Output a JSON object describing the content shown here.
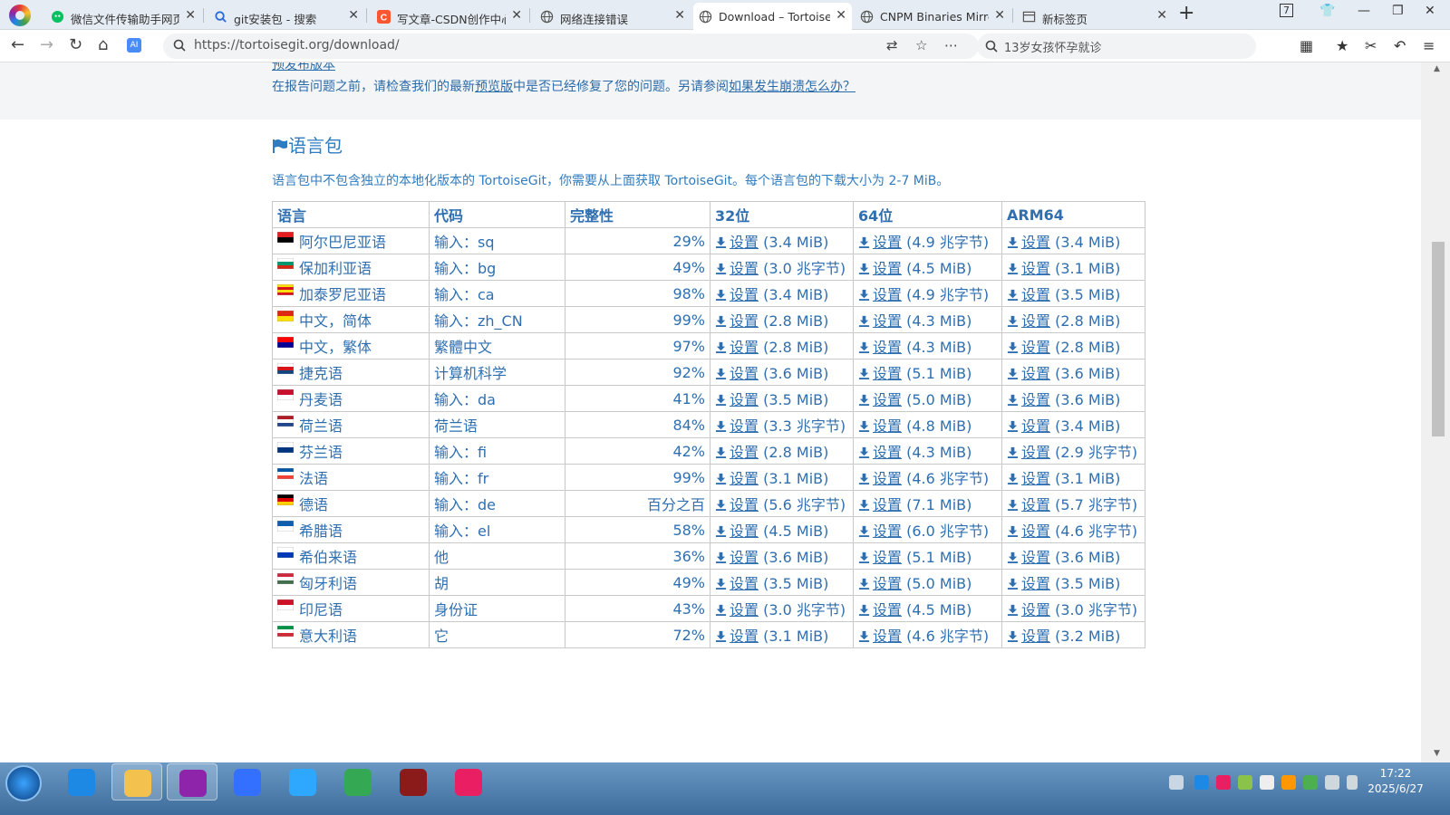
{
  "tabs": [
    {
      "title": "微信文件传输助手网页",
      "icon": "wechat-icon"
    },
    {
      "title": "git安装包 - 搜索",
      "icon": "search-icon"
    },
    {
      "title": "写文章-CSDN创作中心",
      "icon": "csdn-icon"
    },
    {
      "title": "网络连接错误",
      "icon": "globe-icon"
    },
    {
      "title": "Download – TortoiseGit",
      "icon": "globe-icon"
    },
    {
      "title": "CNPM Binaries Mirror",
      "icon": "globe-icon"
    },
    {
      "title": "新标签页",
      "icon": "newtab-icon"
    }
  ],
  "address": {
    "url": "https://tortoisegit.org/download/"
  },
  "search": {
    "text": "13岁女孩怀孕就诊"
  },
  "window": {
    "badge": "7"
  },
  "page": {
    "notice_top": "预发布版本",
    "notice_prefix": "在报告问题之前，请检查我们的最新",
    "notice_link1": "预览版",
    "notice_mid": "中是否已经修复了您的问题。另请参阅",
    "notice_link2": "如果发生崩溃怎么办？",
    "heading": "语言包",
    "description": "语言包中不包含独立的本地化版本的 TortoiseGit，你需要从上面获取 TortoiseGit。每个语言包的下载大小为 2-7 MiB。"
  },
  "table": {
    "headers": [
      "语言",
      "代码",
      "完整性",
      "32位",
      "64位",
      "ARM64"
    ],
    "setup_label": "设置",
    "rows": [
      {
        "lang": "阿尔巴尼亚语",
        "code": "输入：sq",
        "pct": "29%",
        "s32": "(3.4 MiB)",
        "s64": "(4.9 兆字节)",
        "arm": "(3.4 MiB)",
        "flag": [
          "#e41e20",
          "#000000"
        ]
      },
      {
        "lang": "保加利亚语",
        "code": "输入：bg",
        "pct": "49%",
        "s32": "(3.0 兆字节)",
        "s64": "(4.5 MiB)",
        "arm": "(3.1 MiB)",
        "flag": [
          "#ffffff",
          "#00966e",
          "#d62612"
        ]
      },
      {
        "lang": "加泰罗尼亚语",
        "code": "输入：ca",
        "pct": "98%",
        "s32": "(3.4 MiB)",
        "s64": "(4.9 兆字节)",
        "arm": "(3.5 MiB)",
        "flag": [
          "#fcdd09",
          "#da121a",
          "#fcdd09",
          "#da121a"
        ]
      },
      {
        "lang": "中文，简体",
        "code": "输入：zh_CN",
        "pct": "99%",
        "s32": "(2.8 MiB)",
        "s64": "(4.3 MiB)",
        "arm": "(2.8 MiB)",
        "flag": [
          "#de2910",
          "#ffde00"
        ]
      },
      {
        "lang": "中文，繁体",
        "code": "繁體中文",
        "pct": "97%",
        "s32": "(2.8 MiB)",
        "s64": "(4.3 MiB)",
        "arm": "(2.8 MiB)",
        "flag": [
          "#fe0000",
          "#000095"
        ]
      },
      {
        "lang": "捷克语",
        "code": "计算机科学",
        "pct": "92%",
        "s32": "(3.6 MiB)",
        "s64": "(5.1 MiB)",
        "arm": "(3.6 MiB)",
        "flag": [
          "#ffffff",
          "#d7141a",
          "#11457e"
        ]
      },
      {
        "lang": "丹麦语",
        "code": "输入：da",
        "pct": "41%",
        "s32": "(3.5 MiB)",
        "s64": "(5.0 MiB)",
        "arm": "(3.6 MiB)",
        "flag": [
          "#c8102e",
          "#ffffff"
        ]
      },
      {
        "lang": "荷兰语",
        "code": "荷兰语",
        "pct": "84%",
        "s32": "(3.3 兆字节)",
        "s64": "(4.8 MiB)",
        "arm": "(3.4 MiB)",
        "flag": [
          "#ae1c28",
          "#ffffff",
          "#21468b"
        ]
      },
      {
        "lang": "芬兰语",
        "code": "输入：fi",
        "pct": "42%",
        "s32": "(2.8 MiB)",
        "s64": "(4.3 MiB)",
        "arm": "(2.9 兆字节)",
        "flag": [
          "#ffffff",
          "#003580"
        ]
      },
      {
        "lang": "法语",
        "code": "输入：fr",
        "pct": "99%",
        "s32": "(3.1 MiB)",
        "s64": "(4.6 兆字节)",
        "arm": "(3.1 MiB)",
        "flag": [
          "#0055a4",
          "#ffffff",
          "#ef4135"
        ]
      },
      {
        "lang": "德语",
        "code": "输入：de",
        "pct": "百分之百",
        "s32": "(5.6 兆字节)",
        "s64": "(7.1 MiB)",
        "arm": "(5.7 兆字节)",
        "flag": [
          "#000000",
          "#dd0000",
          "#ffce00"
        ]
      },
      {
        "lang": "希腊语",
        "code": "输入：el",
        "pct": "58%",
        "s32": "(4.5 MiB)",
        "s64": "(6.0 兆字节)",
        "arm": "(4.6 兆字节)",
        "flag": [
          "#0d5eaf",
          "#ffffff"
        ]
      },
      {
        "lang": "希伯来语",
        "code": "他",
        "pct": "36%",
        "s32": "(3.6 MiB)",
        "s64": "(5.1 MiB)",
        "arm": "(3.6 MiB)",
        "flag": [
          "#ffffff",
          "#0038b8"
        ]
      },
      {
        "lang": "匈牙利语",
        "code": "胡",
        "pct": "49%",
        "s32": "(3.5 MiB)",
        "s64": "(5.0 MiB)",
        "arm": "(3.5 MiB)",
        "flag": [
          "#cd2a3e",
          "#ffffff",
          "#436f4d"
        ]
      },
      {
        "lang": "印尼语",
        "code": "身份证",
        "pct": "43%",
        "s32": "(3.0 兆字节)",
        "s64": "(4.5 MiB)",
        "arm": "(3.0 兆字节)",
        "flag": [
          "#ce1126",
          "#ffffff"
        ]
      },
      {
        "lang": "意大利语",
        "code": "它",
        "pct": "72%",
        "s32": "(3.1 MiB)",
        "s64": "(4.6 兆字节)",
        "arm": "(3.2 MiB)",
        "flag": [
          "#009246",
          "#ffffff",
          "#ce2b37"
        ]
      }
    ]
  },
  "taskbar": {
    "apps": [
      {
        "name": "ie-icon",
        "color": "#1e88e5"
      },
      {
        "name": "explorer-icon",
        "color": "#f2c14e"
      },
      {
        "name": "browser-logo-icon",
        "color": "#8e24aa"
      },
      {
        "name": "feishu-icon",
        "color": "#3370ff"
      },
      {
        "name": "baidu-netdisk-icon",
        "color": "#2ea7ff"
      },
      {
        "name": "chrome-icon",
        "color": "#34a853"
      },
      {
        "name": "winrar-icon",
        "color": "#8b1a1a"
      },
      {
        "name": "app-pink-icon",
        "color": "#e91e63"
      }
    ],
    "time": "17:22",
    "date": "2025/6/27"
  }
}
